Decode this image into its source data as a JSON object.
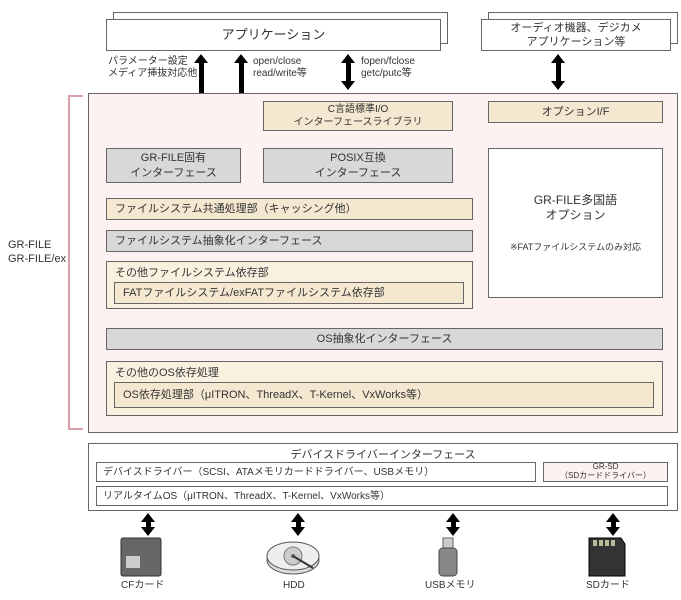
{
  "top": {
    "app": "アプリケーション",
    "audio": "オーディオ機器、デジカメ\nアプリケーション等"
  },
  "api": {
    "param": "パラメーター設定\nメディア挿抜対応他",
    "open": "open/close\nread/write等",
    "fopen": "fopen/fclose\ngetc/putc等"
  },
  "side": "GR-FILE\nGR-FILE/ex",
  "clib": "C言語標準I/O\nインターフェースライブラリ",
  "opt_if": "オプションI/F",
  "grfile_if": "GR-FILE固有\nインターフェース",
  "posix": "POSIX互換\nインターフェース",
  "multi": "GR-FILE多国語\nオプション",
  "multi_note": "※FATファイルシステムのみ対応",
  "cache": "ファイルシステム共通処理部（キャッシング他）",
  "fsabs": "ファイルシステム抽象化インターフェース",
  "otherfs": "その他ファイルシステム依存部",
  "fatfs": "FATファイルシステム/exFATファイルシステム依存部",
  "osabs": "OS抽象化インターフェース",
  "otheros": "その他のOS依存処理",
  "osdep": "OS依存処理部（μITRON、ThreadX、T-Kernel、VxWorks等）",
  "ddi": "デバイスドライバーインターフェース",
  "dd": "デバイスドライバー（SCSI、ATAメモリカードドライバー、USBメモリ）",
  "grsd": "GR-SD\n（SDカードドライバー）",
  "rtos": "リアルタイムOS（μITRON、ThreadX、T-Kernel、VxWorks等）",
  "dev": {
    "cf": "CFカード",
    "hdd": "HDD",
    "usb": "USBメモリ",
    "sd": "SDカード"
  }
}
